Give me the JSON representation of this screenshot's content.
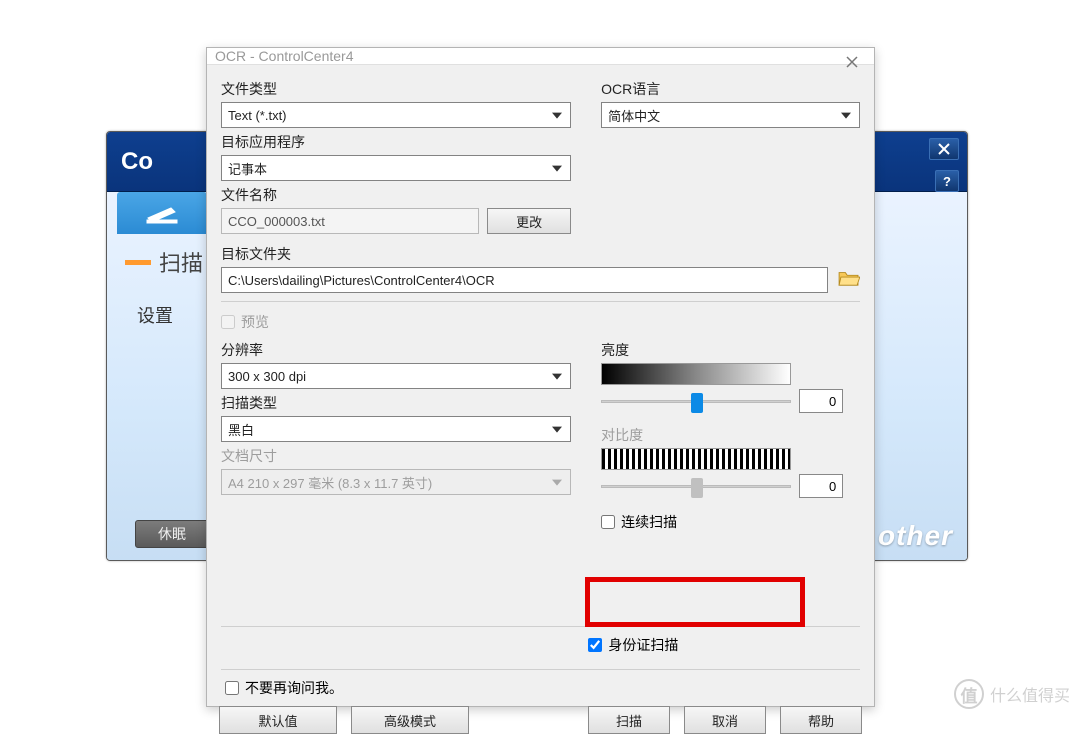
{
  "parent": {
    "title_fragment": "Co",
    "scan_tab_label": "扫描",
    "settings_label": "设置",
    "sleep_btn": "休眠",
    "brand_fragment": "other"
  },
  "dialog": {
    "title": "OCR - ControlCenter4",
    "left": {
      "file_type_label": "文件类型",
      "file_type_value": "Text (*.txt)",
      "target_app_label": "目标应用程序",
      "target_app_value": "记事本",
      "file_name_label": "文件名称",
      "file_name_value": "CCO_000003.txt",
      "change_btn": "更改",
      "target_folder_label": "目标文件夹",
      "target_folder_value": "C:\\Users\\dailing\\Pictures\\ControlCenter4\\OCR",
      "preview_label": "预览",
      "resolution_label": "分辨率",
      "resolution_value": "300 x 300 dpi",
      "scan_type_label": "扫描类型",
      "scan_type_value": "黑白",
      "doc_size_label": "文档尺寸",
      "doc_size_value": "A4 210 x 297 毫米 (8.3 x 11.7 英寸)"
    },
    "right": {
      "ocr_lang_label": "OCR语言",
      "ocr_lang_value": "简体中文",
      "brightness_label": "亮度",
      "brightness_value": "0",
      "contrast_label": "对比度",
      "contrast_value": "0",
      "continuous_scan_label": "连续扫描",
      "id_scan_label": "身份证扫描"
    },
    "dont_ask_label": "不要再询问我。",
    "buttons": {
      "defaults": "默认值",
      "advanced": "高级模式",
      "scan": "扫描",
      "cancel": "取消",
      "help": "帮助"
    }
  },
  "watermark": {
    "symbol": "值",
    "text": "什么值得买"
  }
}
